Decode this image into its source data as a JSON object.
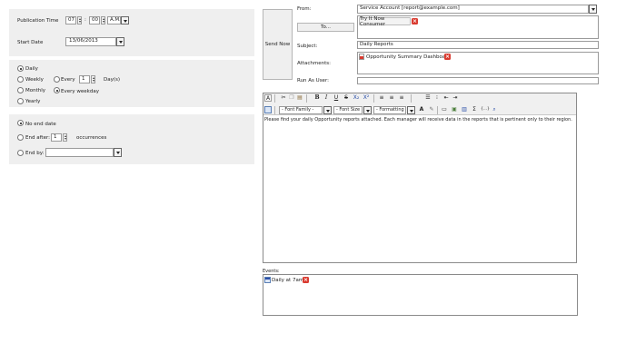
{
  "schedule": {
    "publication_time_label": "Publication Time",
    "hour": "07",
    "time_sep": ":",
    "minute": "00",
    "ampm": "A.M.",
    "start_date_label": "Start Date",
    "start_date": "13/06/2013"
  },
  "recurrence": {
    "daily": "Daily",
    "weekly": "Weekly",
    "monthly": "Monthly",
    "yearly": "Yearly",
    "every_label": "Every",
    "every_value": "1",
    "days_label": "Day(s)",
    "every_weekday": "Every weekday"
  },
  "end": {
    "no_end_date": "No end date",
    "end_after": "End after:",
    "end_after_value": "1",
    "occurrences": "occurrences",
    "end_by": "End by:"
  },
  "email": {
    "send_now": "Send Now",
    "from_label": "From:",
    "from_value": "Service Account [report@example.com]",
    "to_button": "To...",
    "recipient": "Try It Now Consumer",
    "subject_label": "Subject:",
    "subject_value": "Daily Reports",
    "attachments_label": "Attachments:",
    "attachment": "Opportunity Summary Dashboard",
    "run_as_label": "Run As User:",
    "run_as_value": ""
  },
  "editor": {
    "font_family": "- Font Family -",
    "font_size": "- Font Size -",
    "formatting": "- Formatting -",
    "body": "Please find your daily Opportunity reports attached.  Each manager will receive data in the reports that is pertinent only to their region."
  },
  "events": {
    "label": "Events:",
    "item": "Daily at 7am"
  },
  "colors": {
    "panel_bg": "#efefef",
    "remove_red": "#d93a2f"
  }
}
